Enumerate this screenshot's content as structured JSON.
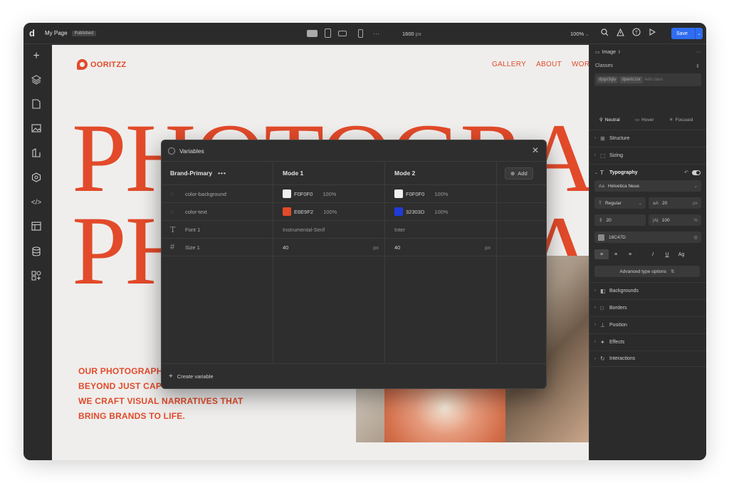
{
  "topbar": {
    "logo": "d",
    "page_name": "My Page",
    "status": "Published",
    "width_value": "1600",
    "width_unit": "px",
    "zoom": "100%",
    "save_label": "Save"
  },
  "site": {
    "brand": "OORITZZ",
    "nav": [
      "GALLERY",
      "ABOUT",
      "WORK"
    ],
    "headline_line1": "PHOTOGRAPHY",
    "headline_line2": "PHOTOGRAPHY",
    "tagline": [
      "OUR PHOTOGRAPHY WORK GOES",
      "BEYOND JUST CAPTURING IMAGES—",
      "WE CRAFT VISUAL NARRATIVES THAT",
      "BRING BRANDS TO LIFE."
    ]
  },
  "variables_modal": {
    "title": "Variables",
    "collection": "Brand-Primary",
    "modes": [
      "Mode 1",
      "Mode 2"
    ],
    "add_label": "Add",
    "rows": [
      {
        "icon": "palette-icon",
        "name": "color-background",
        "m1": "F0F0F0",
        "m1_pct": "100%",
        "m1_color": "#F0F0F0",
        "m2": "F0F0F0",
        "m2_pct": "100%",
        "m2_color": "#F0F0F0"
      },
      {
        "icon": "palette-icon",
        "name": "color-text",
        "m1": "E6E9F2",
        "m1_pct": "100%",
        "m1_color": "#E24A2A",
        "m2": "32303D",
        "m2_pct": "100%",
        "m2_color": "#1F3BD8"
      },
      {
        "icon": "text-icon",
        "name": "Font 1",
        "m1": "Instrumental-Serif",
        "m2": "Inter"
      },
      {
        "icon": "hash-icon",
        "name": "Size 1",
        "m1": "40",
        "m1_unit": "px",
        "m2": "40",
        "m2_unit": "px"
      }
    ],
    "create_label": "Create variable"
  },
  "right_panel": {
    "element": "Image",
    "classes_label": "Classes",
    "class_chips": [
      "dpgo3gly",
      "dpamc1or"
    ],
    "add_class_placeholder": "Add class",
    "states": [
      "Neutral",
      "Hover",
      "Focused"
    ],
    "sections_top": [
      "Structure",
      "Sizing"
    ],
    "typography_label": "Typography",
    "font_family": "Helvetica Neue",
    "font_weight": "Regular",
    "font_size": "20",
    "font_size_unit": "px",
    "line_height": "20",
    "letter_spacing": "100",
    "letter_spacing_unit": "%",
    "color_value": "18C47D",
    "advanced_label": "Advanced type options",
    "sections_bottom": [
      "Backgrounds",
      "Borders",
      "Position",
      "Effects",
      "Interactions"
    ]
  },
  "colors": {
    "accent": "#2F6DF0",
    "brand": "#E24A2A",
    "canvas_bg": "#EFEEEC",
    "chrome_bg": "#2B2B2B"
  }
}
